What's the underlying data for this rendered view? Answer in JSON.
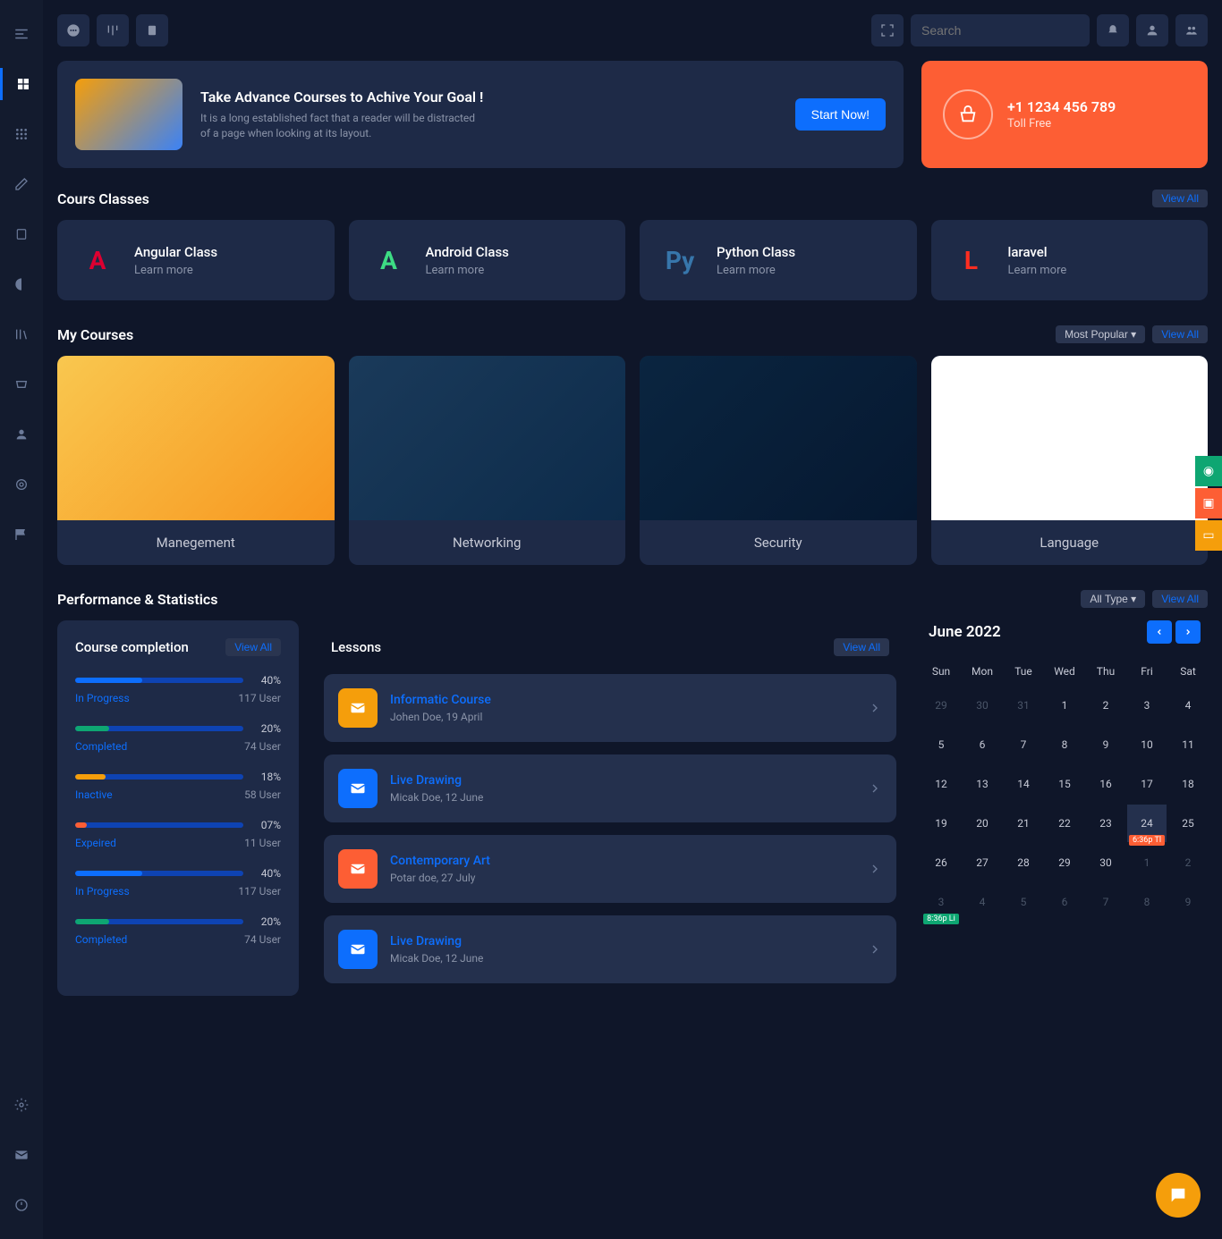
{
  "topbar": {
    "search_placeholder": "Search"
  },
  "banner": {
    "title": "Take Advance Courses to Achive Your Goal !",
    "desc": "It is a long established fact that a reader will be distracted of a page when looking at its layout.",
    "button": "Start Now!"
  },
  "phone": {
    "number": "+1 1234 456 789",
    "label": "Toll Free"
  },
  "sections": {
    "classes_title": "Cours Classes",
    "mycourses_title": "My Courses",
    "perf_title": "Performance & Statistics",
    "viewall": "View All",
    "most_popular": "Most Popular",
    "all_type": "All Type"
  },
  "classes": [
    {
      "title": "Angular Class",
      "sub": "Learn more",
      "color": "#dd0031",
      "glyph": "A"
    },
    {
      "title": "Android Class",
      "sub": "Learn more",
      "color": "#3ddc84",
      "glyph": "A"
    },
    {
      "title": "Python Class",
      "sub": "Learn more",
      "color": "#3776ab",
      "glyph": "Py"
    },
    {
      "title": "laravel",
      "sub": "Learn more",
      "color": "#ff2d20",
      "glyph": "L"
    }
  ],
  "courses": [
    {
      "title": "Manegement",
      "cls": "mgmt"
    },
    {
      "title": "Networking",
      "cls": "net"
    },
    {
      "title": "Security",
      "cls": "sec"
    },
    {
      "title": "Language",
      "cls": "lang"
    }
  ],
  "completion": {
    "title": "Course completion",
    "items": [
      {
        "pct": "40%",
        "fill": 40,
        "color": "#0d6efd",
        "label": "In Progress",
        "users": "117 User"
      },
      {
        "pct": "20%",
        "fill": 20,
        "color": "#0ea672",
        "label": "Completed",
        "users": "74 User"
      },
      {
        "pct": "18%",
        "fill": 18,
        "color": "#f59e0b",
        "label": "Inactive",
        "users": "58 User"
      },
      {
        "pct": "07%",
        "fill": 7,
        "color": "#fd5e34",
        "label": "Expeired",
        "users": "11 User"
      },
      {
        "pct": "40%",
        "fill": 40,
        "color": "#0d6efd",
        "label": "In Progress",
        "users": "117 User"
      },
      {
        "pct": "20%",
        "fill": 20,
        "color": "#0ea672",
        "label": "Completed",
        "users": "74 User"
      }
    ]
  },
  "lessons": {
    "title": "Lessons",
    "items": [
      {
        "title": "Informatic Course",
        "sub": "Johen Doe, 19 April",
        "color": "#f59e0b"
      },
      {
        "title": "Live Drawing",
        "sub": "Micak Doe, 12 June",
        "color": "#0d6efd"
      },
      {
        "title": "Contemporary Art",
        "sub": "Potar doe, 27 July",
        "color": "#fd5e34"
      },
      {
        "title": "Live Drawing",
        "sub": "Micak Doe, 12 June",
        "color": "#0d6efd"
      }
    ]
  },
  "calendar": {
    "month": "June 2022",
    "dow": [
      "Sun",
      "Mon",
      "Tue",
      "Wed",
      "Thu",
      "Fri",
      "Sat"
    ],
    "cells": [
      {
        "d": "29",
        "o": true
      },
      {
        "d": "30",
        "o": true
      },
      {
        "d": "31",
        "o": true
      },
      {
        "d": "1"
      },
      {
        "d": "2"
      },
      {
        "d": "3"
      },
      {
        "d": "4"
      },
      {
        "d": "5"
      },
      {
        "d": "6"
      },
      {
        "d": "7"
      },
      {
        "d": "8"
      },
      {
        "d": "9"
      },
      {
        "d": "10"
      },
      {
        "d": "11"
      },
      {
        "d": "12"
      },
      {
        "d": "13"
      },
      {
        "d": "14"
      },
      {
        "d": "15"
      },
      {
        "d": "16"
      },
      {
        "d": "17"
      },
      {
        "d": "18"
      },
      {
        "d": "19"
      },
      {
        "d": "20"
      },
      {
        "d": "21"
      },
      {
        "d": "22"
      },
      {
        "d": "23"
      },
      {
        "d": "24",
        "hl": true,
        "ev": "6:36p Tl",
        "ec": "orange"
      },
      {
        "d": "25"
      },
      {
        "d": "26"
      },
      {
        "d": "27"
      },
      {
        "d": "28"
      },
      {
        "d": "29"
      },
      {
        "d": "30"
      },
      {
        "d": "1",
        "o": true
      },
      {
        "d": "2",
        "o": true
      },
      {
        "d": "3",
        "o": true,
        "ev": "8:36p Li",
        "ec": "green"
      },
      {
        "d": "4",
        "o": true
      },
      {
        "d": "5",
        "o": true
      },
      {
        "d": "6",
        "o": true
      },
      {
        "d": "7",
        "o": true
      },
      {
        "d": "8",
        "o": true
      },
      {
        "d": "9",
        "o": true
      }
    ]
  }
}
